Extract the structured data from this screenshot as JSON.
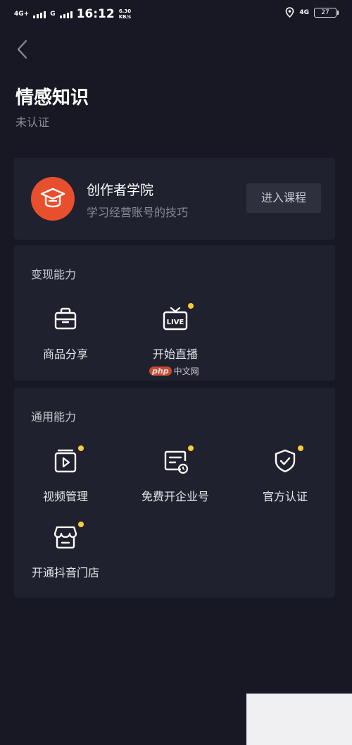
{
  "status_bar": {
    "net_1": "4G+",
    "net_2": "G",
    "time": "16:12",
    "speed_value": "6.30",
    "speed_unit": "KB/s",
    "net_3": "4G",
    "battery": "27"
  },
  "header": {
    "title": "情感知识",
    "subtitle": "未认证"
  },
  "academy": {
    "title": "创作者学院",
    "description": "学习经营账号的技巧",
    "button_label": "进入课程",
    "avatar_color": "#e8502d"
  },
  "monetize": {
    "title": "变现能力",
    "items": [
      {
        "label": "商品分享",
        "icon": "shopping-bag-icon",
        "dot": false
      },
      {
        "label": "开始直播",
        "icon": "live-tv-icon",
        "dot": true
      }
    ]
  },
  "general": {
    "title": "通用能力",
    "items": [
      {
        "label": "视频管理",
        "icon": "video-folder-icon",
        "dot": true
      },
      {
        "label": "免费开企业号",
        "icon": "enterprise-card-icon",
        "dot": true
      },
      {
        "label": "官方认证",
        "icon": "shield-check-icon",
        "dot": true
      },
      {
        "label": "开通抖音门店",
        "icon": "storefront-icon",
        "dot": true
      }
    ]
  },
  "watermark": {
    "badge": "php",
    "text": "中文网"
  },
  "colors": {
    "background": "#171824",
    "card": "#20212e",
    "accent": "#e8502d",
    "dot": "#f6cd3d"
  }
}
